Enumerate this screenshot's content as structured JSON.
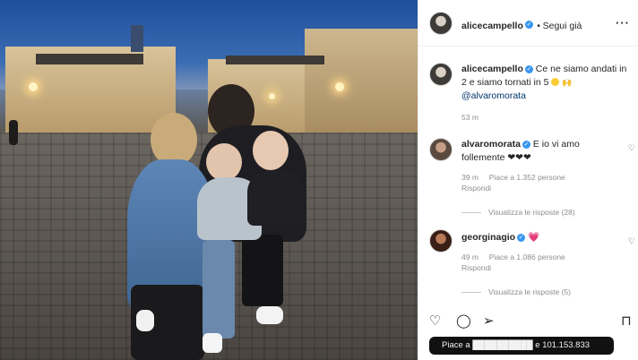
{
  "header": {
    "username": "alicecampello",
    "follow_label": "Segui già",
    "more_icon": "more-dots-icon"
  },
  "caption": {
    "username": "alicecampello",
    "text_part1": "Ce ne siamo andati in 2 e siamo tornati in 5",
    "mention": "@alvaromorata",
    "time": "53 m"
  },
  "comments": [
    {
      "username": "alvaromorata",
      "text": "E io vi amo follemente ❤❤❤",
      "time": "39 m",
      "likes": "Piace a 1.352 persone",
      "reply": "Rispondi",
      "view_replies": "Visualizza le risposte (28)"
    },
    {
      "username": "georginagio",
      "text": "💗",
      "time": "49 m",
      "likes": "Piace a 1.086 persone",
      "reply": "Rispondi",
      "view_replies": "Visualizza le risposte (5)"
    }
  ],
  "footer": {
    "likes_text": "Piace a ██████████ e 101.153.833"
  },
  "colors": {
    "verified": "#3897f0",
    "meta_gray": "#8e8e8e",
    "likes_bar": "#111111"
  }
}
